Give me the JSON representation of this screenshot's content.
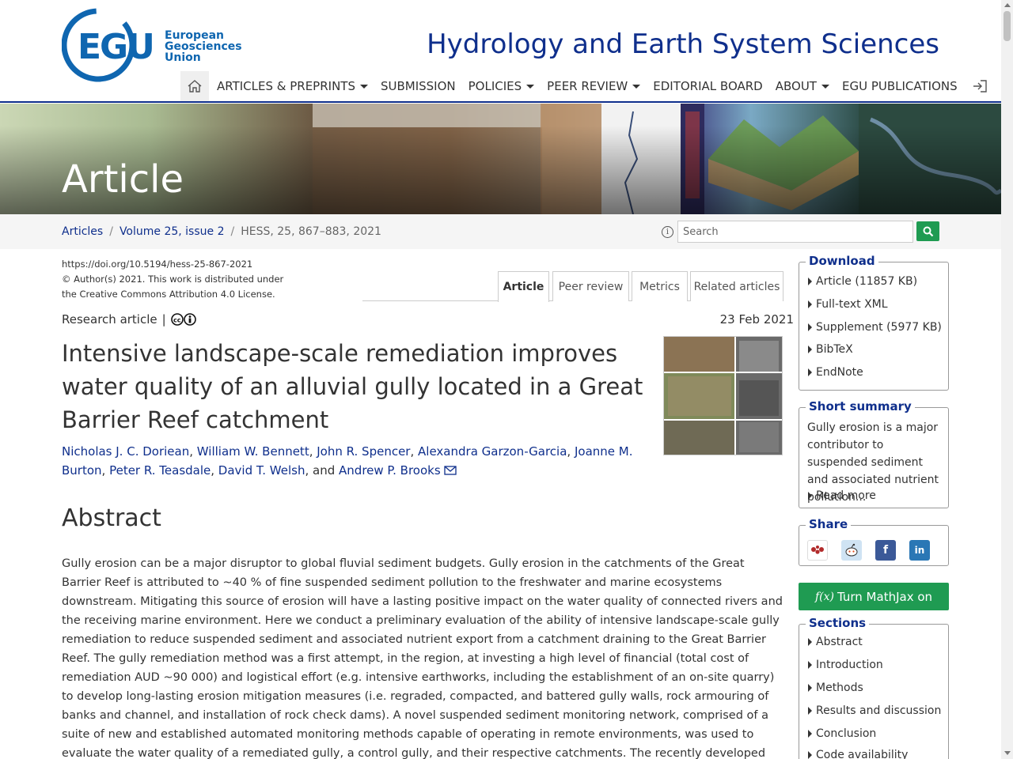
{
  "logo": {
    "abbr": "EGU",
    "line1": "European",
    "line2": "Geosciences",
    "line3": "Union"
  },
  "journal_title": "Hydrology and Earth System Sciences",
  "nav": {
    "items": [
      {
        "label": "ARTICLES & PREPRINTS",
        "dropdown": true
      },
      {
        "label": "SUBMISSION",
        "dropdown": false
      },
      {
        "label": "POLICIES",
        "dropdown": true
      },
      {
        "label": "PEER REVIEW",
        "dropdown": true
      },
      {
        "label": "EDITORIAL BOARD",
        "dropdown": false
      },
      {
        "label": "ABOUT",
        "dropdown": true
      },
      {
        "label": "EGU PUBLICATIONS",
        "dropdown": false
      }
    ]
  },
  "banner": {
    "title": "Article"
  },
  "breadcrumb": {
    "articles": "Articles",
    "volume": "Volume 25, issue 2",
    "current": "HESS, 25, 867–883, 2021"
  },
  "search": {
    "placeholder": "Search"
  },
  "meta": {
    "doi": "https://doi.org/10.5194/hess-25-867-2021",
    "copyright": "© Author(s) 2021. This work is distributed under",
    "license": "the Creative Commons Attribution 4.0 License."
  },
  "tabs": [
    "Article",
    "Peer review",
    "Metrics",
    "Related articles"
  ],
  "article": {
    "type": "Research article",
    "separator": "|",
    "date": "23 Feb 2021",
    "title": "Intensive landscape-scale remediation improves water quality of an alluvial gully located in a Great Barrier Reef catchment",
    "authors": [
      "Nicholas J. C. Doriean",
      "William W. Bennett",
      "John R. Spencer",
      "Alexandra Garzon-Garcia",
      "Joanne M. Burton",
      "Peter R. Teasdale",
      "David T. Welsh"
    ],
    "last_author": "Andrew P. Brooks",
    "and_text": "and",
    "abstract_heading": "Abstract",
    "abstract": "Gully erosion can be a major disruptor to global fluvial sediment budgets. Gully erosion in the catchments of the Great Barrier Reef is attributed to ~40 % of fine suspended sediment pollution to the freshwater and marine ecosystems downstream. Mitigating this source of erosion will have a lasting positive impact on the water quality of connected rivers and the receiving marine environment. Here we conduct a preliminary evaluation of the ability of intensive landscape-scale gully remediation to reduce suspended sediment and associated nutrient export from a catchment draining to the Great Barrier Reef. The gully remediation method was a first attempt, in the region, at investing a high level of financial (total cost of remediation AUD ~90 000) and logistical effort (e.g. intensive earthworks, including the establishment of an on-site quarry) to develop long-lasting erosion mitigation measures (i.e. regraded, compacted, and battered gully walls, rock armouring of banks and channel, and installation of rock check dams). A novel suspended sediment monitoring network, comprised of a suite of new and established automated monitoring methods capable of operating in remote environments, was used to evaluate the water quality of a remediated gully, a control gully, and their respective catchments. The recently developed pumped active suspended sediment (PASS) sampler"
  },
  "sidebar": {
    "download": {
      "title": "Download",
      "items": [
        "Article (11857 KB)",
        "Full-text XML",
        "Supplement (5977 KB)",
        "BibTeX",
        "EndNote"
      ]
    },
    "short_summary": {
      "title": "Short summary",
      "text": "Gully erosion is a major contributor to suspended sediment and associated nutrient pollution...",
      "read_more": "Read more"
    },
    "share": {
      "title": "Share",
      "icons": [
        "mendeley-icon",
        "reddit-icon",
        "facebook-icon",
        "linkedin-icon"
      ]
    },
    "mathjax": {
      "label": "Turn MathJax on",
      "symbol": "f(x)"
    },
    "sections": {
      "title": "Sections",
      "items": [
        "Abstract",
        "Introduction",
        "Methods",
        "Results and discussion",
        "Conclusion",
        "Code availability"
      ]
    }
  },
  "colors": {
    "brand": "#0f2f8c",
    "green": "#1f9b52",
    "text": "#333333"
  }
}
